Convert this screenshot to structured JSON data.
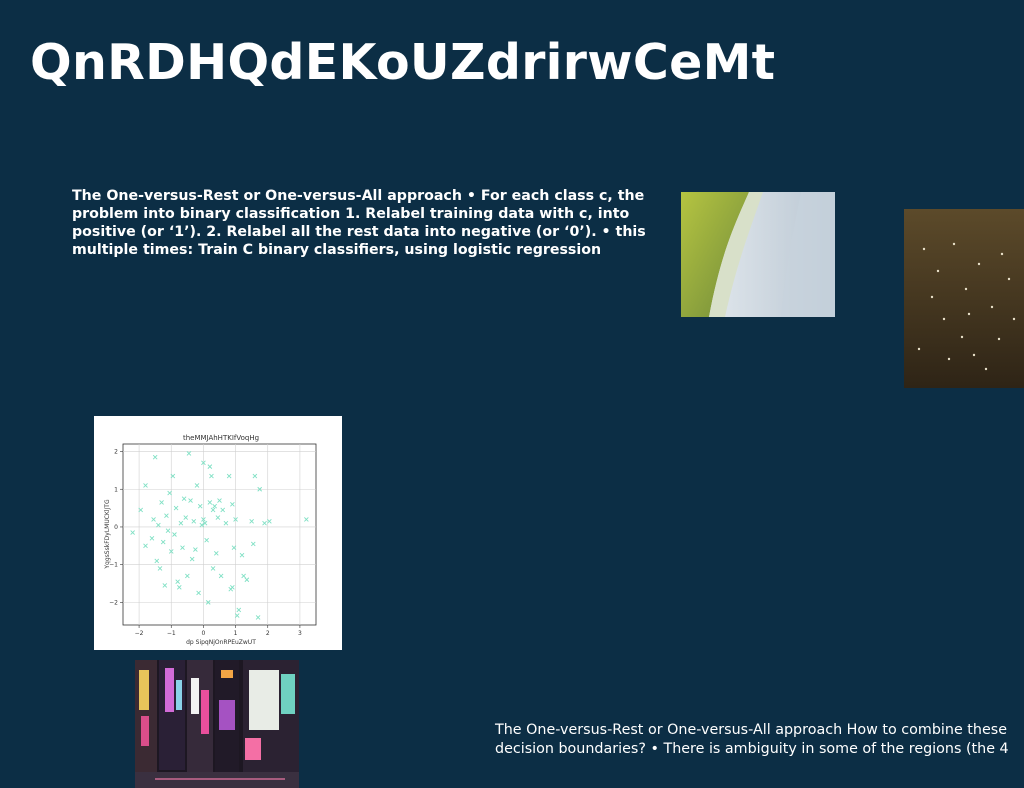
{
  "slide": {
    "title": "QnRDHQdEKoUZdrirwCeMt",
    "paragraph_1": "The One-versus-Rest or One-versus-All approach • For each class c, the problem into binary classification 1. Relabel training data with c, into positive (or ‘1’). 2. Relabel all the rest data into negative (or ‘0’). • this multiple times: Train C binary classifiers, using logistic regression",
    "paragraph_2": "The One-versus-Rest or One-versus-All approach How to combine these decision boundaries? • There is ambiguity in some of the regions (the 4"
  },
  "chart_data": {
    "type": "scatter",
    "title": "theMMJAhHTKIfVoqHg",
    "xlabel": "dp SipqNjOnRPEuZwUT",
    "ylabel": "YqgsSskFDyLMUCKlJTG",
    "xlim": [
      -2.5,
      3.5
    ],
    "ylim": [
      -2.6,
      2.2
    ],
    "xticks": [
      -2,
      -1,
      0,
      1,
      2,
      3
    ],
    "yticks": [
      -2,
      -1,
      0,
      1,
      2
    ],
    "grid": true,
    "marker": "x",
    "color": "#7fe0c4",
    "points": [
      [
        -2.2,
        -0.15
      ],
      [
        -1.95,
        0.45
      ],
      [
        -1.8,
        -0.5
      ],
      [
        -1.6,
        -0.3
      ],
      [
        -1.55,
        0.2
      ],
      [
        -1.5,
        1.85
      ],
      [
        -1.45,
        -0.9
      ],
      [
        -1.4,
        0.05
      ],
      [
        -1.35,
        -1.1
      ],
      [
        -1.3,
        0.65
      ],
      [
        -1.25,
        -0.4
      ],
      [
        -1.2,
        -1.55
      ],
      [
        -1.15,
        0.3
      ],
      [
        -1.1,
        -0.1
      ],
      [
        -1.05,
        0.9
      ],
      [
        -1.0,
        -0.65
      ],
      [
        -0.95,
        1.35
      ],
      [
        -0.9,
        -0.2
      ],
      [
        -0.85,
        0.5
      ],
      [
        -0.8,
        -1.45
      ],
      [
        -0.75,
        -1.6
      ],
      [
        -0.7,
        0.1
      ],
      [
        -0.65,
        -0.55
      ],
      [
        -0.6,
        0.75
      ],
      [
        -0.55,
        0.25
      ],
      [
        -0.5,
        -1.3
      ],
      [
        -0.45,
        1.95
      ],
      [
        -0.4,
        0.7
      ],
      [
        -0.35,
        -0.85
      ],
      [
        -0.3,
        0.15
      ],
      [
        -0.25,
        -0.6
      ],
      [
        -0.2,
        1.1
      ],
      [
        -0.15,
        -1.75
      ],
      [
        -0.1,
        0.55
      ],
      [
        -0.05,
        0.05
      ],
      [
        0.0,
        0.2
      ],
      [
        0.0,
        1.7
      ],
      [
        0.05,
        0.1
      ],
      [
        0.1,
        -0.35
      ],
      [
        0.15,
        -2.0
      ],
      [
        0.2,
        1.6
      ],
      [
        0.2,
        0.65
      ],
      [
        0.25,
        1.35
      ],
      [
        0.3,
        -1.1
      ],
      [
        0.3,
        0.45
      ],
      [
        0.35,
        0.55
      ],
      [
        0.4,
        -0.7
      ],
      [
        0.45,
        0.25
      ],
      [
        0.5,
        0.7
      ],
      [
        0.55,
        -1.3
      ],
      [
        0.6,
        0.45
      ],
      [
        0.7,
        0.1
      ],
      [
        0.8,
        1.35
      ],
      [
        0.85,
        -1.65
      ],
      [
        0.9,
        0.6
      ],
      [
        0.95,
        -0.55
      ],
      [
        1.0,
        0.2
      ],
      [
        1.05,
        -2.35
      ],
      [
        1.1,
        -2.2
      ],
      [
        1.2,
        -0.75
      ],
      [
        1.25,
        -1.3
      ],
      [
        1.35,
        -1.4
      ],
      [
        1.5,
        0.15
      ],
      [
        1.55,
        -0.45
      ],
      [
        1.6,
        1.35
      ],
      [
        1.7,
        -2.4
      ],
      [
        1.75,
        1.0
      ],
      [
        1.9,
        0.1
      ],
      [
        2.05,
        0.15
      ],
      [
        3.2,
        0.2
      ],
      [
        0.9,
        -1.6
      ],
      [
        -1.8,
        1.1
      ]
    ]
  },
  "images": [
    {
      "name": "beach-aerial-photo"
    },
    {
      "name": "birds-on-sand-photo"
    },
    {
      "name": "night-street-photo"
    }
  ]
}
